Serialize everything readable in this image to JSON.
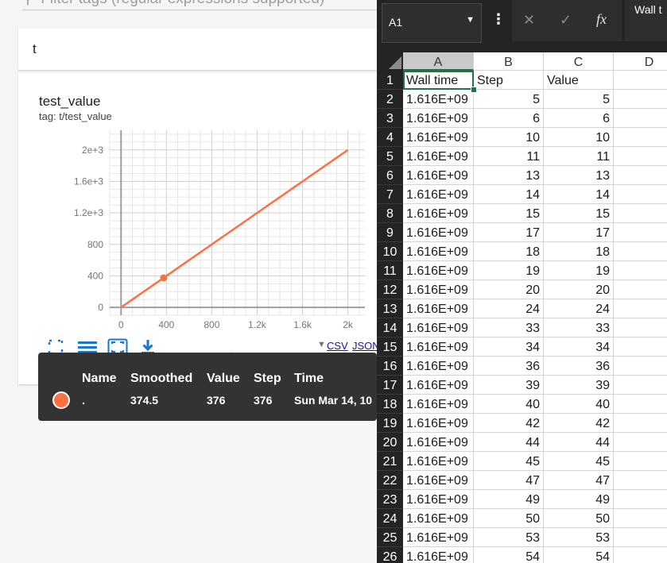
{
  "filter": {
    "text": "Filter tags (regular expressions supported)"
  },
  "category": {
    "title": "t"
  },
  "chart_card": {
    "title": "test_value",
    "tag": "tag: t/test_value"
  },
  "chart_data": {
    "type": "line",
    "title": "test_value",
    "x": [
      0,
      2000
    ],
    "series": [
      {
        "values": [
          0,
          2000
        ],
        "color": "#ff7043"
      }
    ],
    "highlight_point": {
      "x": 376,
      "y": 374.5
    },
    "xlim": [
      -100,
      2150
    ],
    "ylim": [
      -100,
      2250
    ],
    "x_ticks": [
      0,
      400,
      800,
      1200,
      1600,
      2000
    ],
    "x_tick_labels": [
      "0",
      "400",
      "800",
      "1.2k",
      "1.6k",
      "2k"
    ],
    "y_ticks": [
      0,
      400,
      800,
      1200,
      1600,
      2000
    ],
    "y_tick_labels": [
      "0",
      "400",
      "800",
      "1.2e+3",
      "1.6e+3",
      "2e+3"
    ],
    "grid": true
  },
  "toolbar": {
    "run_selector": ".",
    "csv_label": "CSV",
    "json_label": "JSON",
    "icons": [
      "fullscreen-icon",
      "lines-icon",
      "fit-domain-icon",
      "download-icon"
    ]
  },
  "tooltip": {
    "headers": [
      "Name",
      "Smoothed",
      "Value",
      "Step",
      "Time"
    ],
    "row": {
      "name": ".",
      "smoothed": "374.5",
      "value": "376",
      "step": "376",
      "time": "Sun Mar 14, 10"
    },
    "dot_color": "#ff7043"
  },
  "sheet": {
    "name_box": "A1",
    "formula_text": "Wall t",
    "columns": [
      "A",
      "B",
      "C",
      "D"
    ],
    "headers": [
      "Wall time",
      "Step",
      "Value"
    ],
    "rows": [
      {
        "n": "1",
        "a": "Wall time",
        "b": "Step",
        "c": "Value"
      },
      {
        "n": "2",
        "a": "1.616E+09",
        "b": "5",
        "c": "5"
      },
      {
        "n": "3",
        "a": "1.616E+09",
        "b": "6",
        "c": "6"
      },
      {
        "n": "4",
        "a": "1.616E+09",
        "b": "10",
        "c": "10"
      },
      {
        "n": "5",
        "a": "1.616E+09",
        "b": "11",
        "c": "11"
      },
      {
        "n": "6",
        "a": "1.616E+09",
        "b": "13",
        "c": "13"
      },
      {
        "n": "7",
        "a": "1.616E+09",
        "b": "14",
        "c": "14"
      },
      {
        "n": "8",
        "a": "1.616E+09",
        "b": "15",
        "c": "15"
      },
      {
        "n": "9",
        "a": "1.616E+09",
        "b": "17",
        "c": "17"
      },
      {
        "n": "10",
        "a": "1.616E+09",
        "b": "18",
        "c": "18"
      },
      {
        "n": "11",
        "a": "1.616E+09",
        "b": "19",
        "c": "19"
      },
      {
        "n": "12",
        "a": "1.616E+09",
        "b": "20",
        "c": "20"
      },
      {
        "n": "13",
        "a": "1.616E+09",
        "b": "24",
        "c": "24"
      },
      {
        "n": "14",
        "a": "1.616E+09",
        "b": "33",
        "c": "33"
      },
      {
        "n": "15",
        "a": "1.616E+09",
        "b": "34",
        "c": "34"
      },
      {
        "n": "16",
        "a": "1.616E+09",
        "b": "36",
        "c": "36"
      },
      {
        "n": "17",
        "a": "1.616E+09",
        "b": "39",
        "c": "39"
      },
      {
        "n": "18",
        "a": "1.616E+09",
        "b": "40",
        "c": "40"
      },
      {
        "n": "19",
        "a": "1.616E+09",
        "b": "42",
        "c": "42"
      },
      {
        "n": "20",
        "a": "1.616E+09",
        "b": "44",
        "c": "44"
      },
      {
        "n": "21",
        "a": "1.616E+09",
        "b": "45",
        "c": "45"
      },
      {
        "n": "22",
        "a": "1.616E+09",
        "b": "47",
        "c": "47"
      },
      {
        "n": "23",
        "a": "1.616E+09",
        "b": "49",
        "c": "49"
      },
      {
        "n": "24",
        "a": "1.616E+09",
        "b": "50",
        "c": "50"
      },
      {
        "n": "25",
        "a": "1.616E+09",
        "b": "53",
        "c": "53"
      },
      {
        "n": "26",
        "a": "1.616E+09",
        "b": "54",
        "c": "54"
      }
    ]
  }
}
